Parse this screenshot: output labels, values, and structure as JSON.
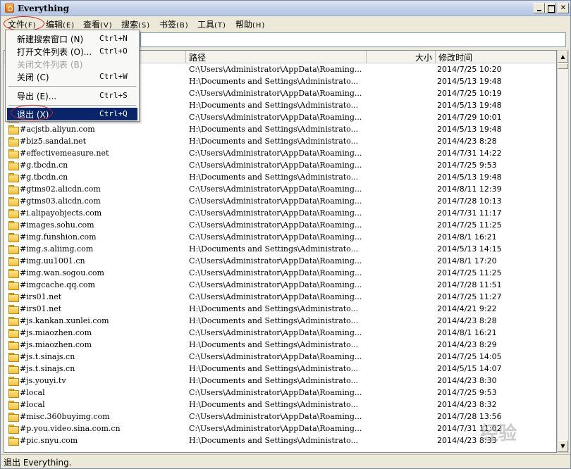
{
  "window": {
    "title": "Everything"
  },
  "menubar": [
    {
      "label": "文件",
      "acc": "(F)"
    },
    {
      "label": "编辑",
      "acc": "(E)"
    },
    {
      "label": "查看",
      "acc": "(V)"
    },
    {
      "label": "搜索",
      "acc": "(S)"
    },
    {
      "label": "书签",
      "acc": "(B)"
    },
    {
      "label": "工具",
      "acc": "(T)"
    },
    {
      "label": "帮助",
      "acc": "(H)"
    }
  ],
  "file_menu": [
    {
      "label": "新建搜索窗口 (N)",
      "shortcut": "Ctrl+N"
    },
    {
      "label": "打开文件列表 (O)...",
      "shortcut": "Ctrl+O"
    },
    {
      "label": "关闭文件列表 (B)",
      "shortcut": ""
    },
    {
      "label": "关闭 (C)",
      "shortcut": "Ctrl+W"
    },
    {
      "label": "导出 (E)...",
      "shortcut": "Ctrl+S"
    },
    {
      "label": "退出 (X)",
      "shortcut": "Ctrl+Q"
    }
  ],
  "search": {
    "value": ""
  },
  "columns": {
    "name": "",
    "path": "路径",
    "size": "大小",
    "date": "修改时间"
  },
  "rows": [
    {
      "name": "",
      "path": "C:\\Users\\Administrator\\AppData\\Roaming...",
      "date": "2014/7/25 10:20"
    },
    {
      "name": "",
      "path": "H:\\Documents and Settings\\Administrato...",
      "date": "2014/5/13 19:48"
    },
    {
      "name": "",
      "path": "C:\\Users\\Administrator\\AppData\\Roaming...",
      "date": "2014/7/25 10:19"
    },
    {
      "name": "",
      "path": "H:\\Documents and Settings\\Administrato...",
      "date": "2014/5/13 19:48"
    },
    {
      "name": "",
      "path": "C:\\Users\\Administrator\\AppData\\Roaming...",
      "date": "2014/7/29 10:01"
    },
    {
      "name": "#acjstb.aliyun.com",
      "path": "H:\\Documents and Settings\\Administrato...",
      "date": "2014/5/13 19:48"
    },
    {
      "name": "#biz5.sandai.net",
      "path": "H:\\Documents and Settings\\Administrato...",
      "date": "2014/4/23 8:28"
    },
    {
      "name": "#effectivemeasure.net",
      "path": "C:\\Users\\Administrator\\AppData\\Roaming...",
      "date": "2014/7/31 14:22"
    },
    {
      "name": "#g.tbcdn.cn",
      "path": "C:\\Users\\Administrator\\AppData\\Roaming...",
      "date": "2014/7/25 9:53"
    },
    {
      "name": "#g.tbcdn.cn",
      "path": "H:\\Documents and Settings\\Administrato...",
      "date": "2014/5/13 19:48"
    },
    {
      "name": "#gtms02.alicdn.com",
      "path": "C:\\Users\\Administrator\\AppData\\Roaming...",
      "date": "2014/8/11 12:39"
    },
    {
      "name": "#gtms03.alicdn.com",
      "path": "C:\\Users\\Administrator\\AppData\\Roaming...",
      "date": "2014/7/28 10:13"
    },
    {
      "name": "#i.alipayobjects.com",
      "path": "C:\\Users\\Administrator\\AppData\\Roaming...",
      "date": "2014/7/31 11:17"
    },
    {
      "name": "#images.sohu.com",
      "path": "C:\\Users\\Administrator\\AppData\\Roaming...",
      "date": "2014/7/25 11:25"
    },
    {
      "name": "#img.funshion.com",
      "path": "C:\\Users\\Administrator\\AppData\\Roaming...",
      "date": "2014/8/1 16:21"
    },
    {
      "name": "#img.s.aliimg.com",
      "path": "H:\\Documents and Settings\\Administrato...",
      "date": "2014/5/13 14:15"
    },
    {
      "name": "#img.uu1001.cn",
      "path": "C:\\Users\\Administrator\\AppData\\Roaming...",
      "date": "2014/8/1 17:20"
    },
    {
      "name": "#img.wan.sogou.com",
      "path": "C:\\Users\\Administrator\\AppData\\Roaming...",
      "date": "2014/7/25 11:25"
    },
    {
      "name": "#imgcache.qq.com",
      "path": "C:\\Users\\Administrator\\AppData\\Roaming...",
      "date": "2014/7/28 11:51"
    },
    {
      "name": "#irs01.net",
      "path": "C:\\Users\\Administrator\\AppData\\Roaming...",
      "date": "2014/7/25 11:27"
    },
    {
      "name": "#irs01.net",
      "path": "H:\\Documents and Settings\\Administrato...",
      "date": "2014/4/21 9:22"
    },
    {
      "name": "#js.kankan.xunlei.com",
      "path": "H:\\Documents and Settings\\Administrato...",
      "date": "2014/4/23 8:28"
    },
    {
      "name": "#js.miaozhen.com",
      "path": "C:\\Users\\Administrator\\AppData\\Roaming...",
      "date": "2014/8/1 16:21"
    },
    {
      "name": "#js.miaozhen.com",
      "path": "H:\\Documents and Settings\\Administrato...",
      "date": "2014/4/23 8:29"
    },
    {
      "name": "#js.t.sinajs.cn",
      "path": "C:\\Users\\Administrator\\AppData\\Roaming...",
      "date": "2014/7/25 14:05"
    },
    {
      "name": "#js.t.sinajs.cn",
      "path": "H:\\Documents and Settings\\Administrato...",
      "date": "2014/5/15 14:07"
    },
    {
      "name": "#js.youyi.tv",
      "path": "H:\\Documents and Settings\\Administrato...",
      "date": "2014/4/23 8:30"
    },
    {
      "name": "#local",
      "path": "C:\\Users\\Administrator\\AppData\\Roaming...",
      "date": "2014/7/25 9:53"
    },
    {
      "name": "#local",
      "path": "H:\\Documents and Settings\\Administrato...",
      "date": "2014/4/23 8:32"
    },
    {
      "name": "#misc.360buyimg.com",
      "path": "C:\\Users\\Administrator\\AppData\\Roaming...",
      "date": "2014/7/28 13:56"
    },
    {
      "name": "#p.you.video.sina.com.cn",
      "path": "C:\\Users\\Administrator\\AppData\\Roaming...",
      "date": "2014/7/31 11:02"
    },
    {
      "name": "#pic.snyu.com",
      "path": "H:\\Documents and Settings\\Administrato...",
      "date": "2014/4/23 8:33"
    }
  ],
  "status": "退出 Everything.",
  "watermark": "经验"
}
